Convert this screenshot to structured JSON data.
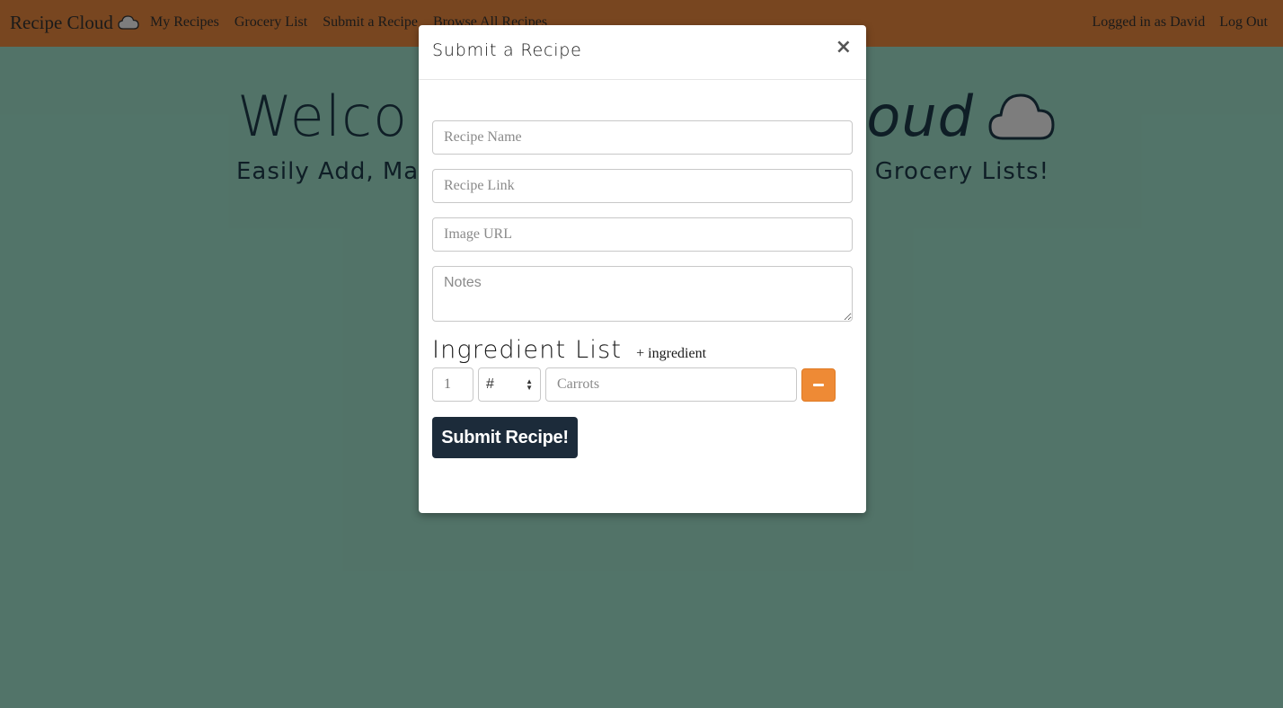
{
  "navbar": {
    "brand": "Recipe Cloud",
    "links": [
      "My Recipes",
      "Grocery List",
      "Submit a Recipe",
      "Browse All Recipes"
    ],
    "user": "Logged in as David",
    "logout": "Log Out"
  },
  "hero": {
    "title_left": "Welco",
    "title_right": "oud",
    "subtitle_left": "Easily Add, Mar",
    "subtitle_right": "e Grocery Lists!"
  },
  "modal": {
    "title": "Submit a Recipe",
    "close": "×",
    "fields": {
      "recipe_name_placeholder": "Recipe Name",
      "recipe_link_placeholder": "Recipe Link",
      "image_url_placeholder": "Image URL",
      "notes_placeholder": "Notes"
    },
    "ingredients": {
      "title": "Ingredient List",
      "add_label": "+ ingredient",
      "rows": [
        {
          "qty_placeholder": "1",
          "unit": "#",
          "name_placeholder": "Carrots"
        }
      ]
    },
    "submit_label": "Submit Recipe!"
  },
  "colors": {
    "navbar": "#7a4720",
    "background": "#53756a",
    "submit": "#1c2b3a",
    "remove": "#ee8a35"
  }
}
